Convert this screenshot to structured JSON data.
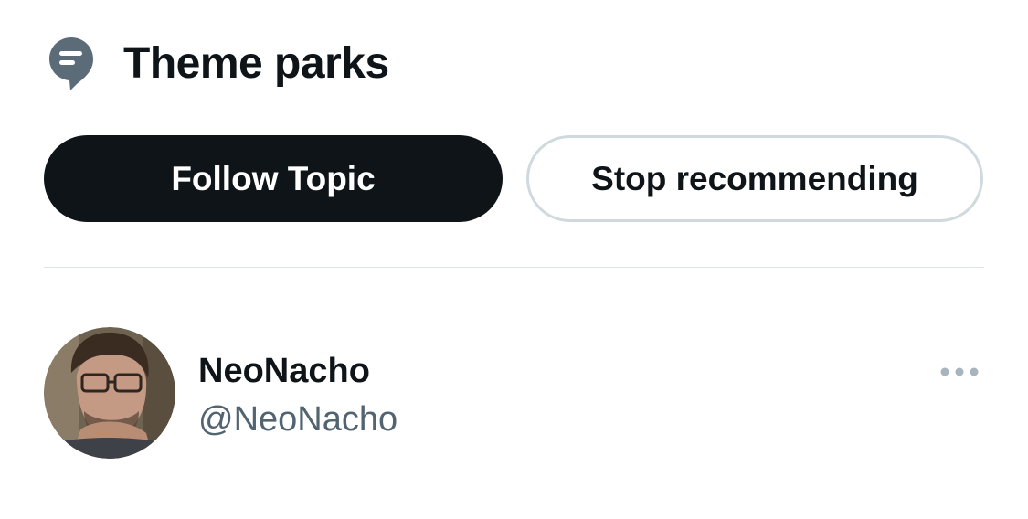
{
  "topic": {
    "title": "Theme parks",
    "icon": "topic-icon"
  },
  "actions": {
    "follow_label": "Follow Topic",
    "stop_label": "Stop recommending"
  },
  "user": {
    "display_name": "NeoNacho",
    "handle": "@NeoNacho",
    "avatar_icon": "avatar",
    "more_icon": "more-icon"
  },
  "colors": {
    "text_primary": "#0f1419",
    "text_secondary": "#536471",
    "icon_gray": "#5b6b78",
    "border": "#cfd9de",
    "divider": "#dfe4e8",
    "more_dots": "#a8b5bf"
  }
}
